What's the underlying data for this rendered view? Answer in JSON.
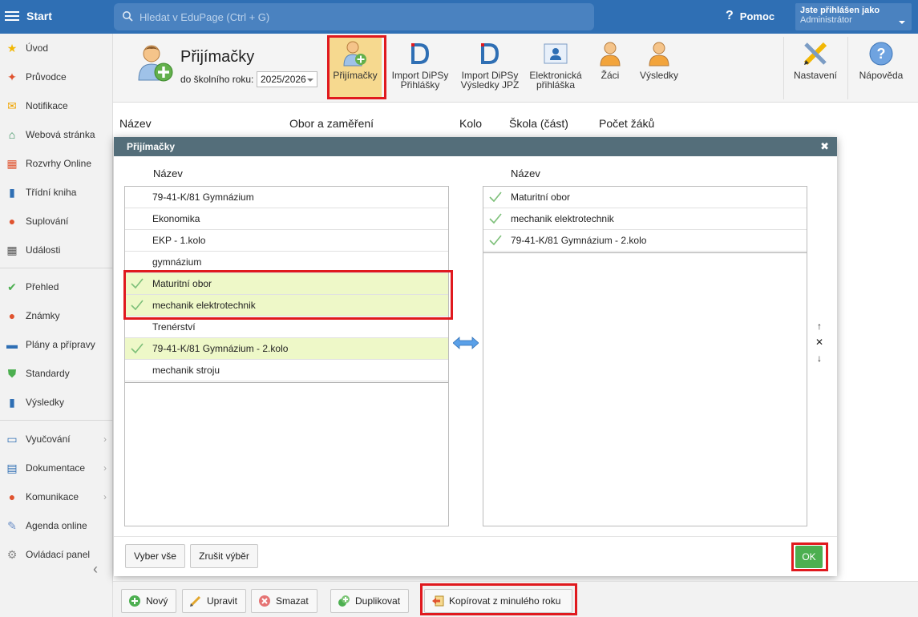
{
  "topbar": {
    "start_label": "Start",
    "search_placeholder": "Hledat v EduPage (Ctrl + G)",
    "help_label": "Pomoc",
    "user_line1": "Jste přihlášen jako",
    "user_line2": "Administrátor"
  },
  "sidebar": {
    "items": [
      {
        "label": "Úvod",
        "icon": "star-icon",
        "color": "#f2b705"
      },
      {
        "label": "Průvodce",
        "icon": "magic-wand-icon",
        "color": "#e0532f"
      },
      {
        "label": "Notifikace",
        "icon": "envelope-icon",
        "color": "#f0a400"
      },
      {
        "label": "Webová stránka",
        "icon": "home-icon",
        "color": "#2e8b57"
      },
      {
        "label": "Rozvrhy Online",
        "icon": "grid-icon",
        "color": "#e0532f"
      },
      {
        "label": "Třídní kniha",
        "icon": "book-icon",
        "color": "#2f6fb4"
      },
      {
        "label": "Suplování",
        "icon": "person-icon",
        "color": "#e0532f"
      },
      {
        "label": "Události",
        "icon": "calendar-icon",
        "color": "#555555"
      },
      {
        "label": "Přehled",
        "icon": "check-circle-icon",
        "color": "#4caf50"
      },
      {
        "label": "Známky",
        "icon": "grade-icon",
        "color": "#e0532f"
      },
      {
        "label": "Plány a přípravy",
        "icon": "briefcase-icon",
        "color": "#2f6fb4"
      },
      {
        "label": "Standardy",
        "icon": "shield-icon",
        "color": "#4caf50"
      },
      {
        "label": "Výsledky",
        "icon": "bar-chart-icon",
        "color": "#2f6fb4"
      },
      {
        "label": "Vyučování",
        "icon": "open-book-icon",
        "color": "#2f6fb4"
      },
      {
        "label": "Dokumentace",
        "icon": "document-icon",
        "color": "#2f6fb4"
      },
      {
        "label": "Komunikace",
        "icon": "chat-icon",
        "color": "#e0532f"
      },
      {
        "label": "Agenda online",
        "icon": "pen-icon",
        "color": "#6b8fc7"
      },
      {
        "label": "Ovládací panel",
        "icon": "gear-icon",
        "color": "#888888"
      }
    ]
  },
  "module": {
    "title": "Přijímačky",
    "year_label": "do školního roku:",
    "year_value": "2025/2026",
    "toolbar": [
      {
        "label1": "Přijímačky",
        "label2": ""
      },
      {
        "label1": "Import DiPSy",
        "label2": "Přihlášky"
      },
      {
        "label1": "Import DiPSy",
        "label2": "Výsledky JPZ"
      },
      {
        "label1": "Elektronická",
        "label2": "přihláška"
      },
      {
        "label1": "Žáci",
        "label2": ""
      },
      {
        "label1": "Výsledky",
        "label2": ""
      },
      {
        "label1": "Nastavení",
        "label2": ""
      },
      {
        "label1": "Nápověda",
        "label2": ""
      }
    ]
  },
  "bg_table": {
    "columns": [
      "Název",
      "Obor a zaměření",
      "Kolo",
      "Škola (část)",
      "Počet žáků"
    ]
  },
  "dialog": {
    "title": "Přijímačky",
    "left_header": "Název",
    "right_header": "Název",
    "left_items": [
      {
        "label": "79-41-K/81 Gymnázium",
        "checked": false
      },
      {
        "label": "Ekonomika",
        "checked": false
      },
      {
        "label": "EKP - 1.kolo",
        "checked": false
      },
      {
        "label": "gymnázium",
        "checked": false
      },
      {
        "label": "Maturitní obor",
        "checked": true
      },
      {
        "label": "mechanik elektrotechnik",
        "checked": true
      },
      {
        "label": "Trenérství",
        "checked": false
      },
      {
        "label": "79-41-K/81 Gymnázium - 2.kolo",
        "checked": true
      },
      {
        "label": "mechanik stroju",
        "checked": false
      }
    ],
    "right_items": [
      {
        "label": "Maturitní obor"
      },
      {
        "label": "mechanik elektrotechnik"
      },
      {
        "label": "79-41-K/81 Gymnázium - 2.kolo"
      }
    ],
    "select_all": "Vyber vše",
    "clear_selection": "Zrušit výběr",
    "ok": "OK",
    "order_up": "↑",
    "order_remove": "✕",
    "order_down": "↓"
  },
  "bottombar": {
    "new": "Nový",
    "edit": "Upravit",
    "delete": "Smazat",
    "duplicate": "Duplikovat",
    "copy_prev": "Kopírovat z minulého roku"
  },
  "colors": {
    "brand_blue": "#2f6fb4",
    "dialog_title": "#546e7a",
    "selected_row": "#eef8c8",
    "ok_green": "#4caf50",
    "highlight_red": "#e0191e",
    "active_tool": "#f6d98f"
  }
}
